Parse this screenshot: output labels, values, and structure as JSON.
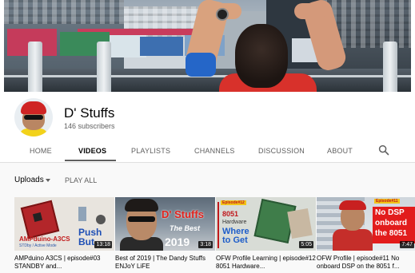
{
  "channel": {
    "name": "D' Stuffs",
    "subscribers": "146 subscribers"
  },
  "tabs": [
    {
      "label": "HOME"
    },
    {
      "label": "VIDEOS",
      "active": true
    },
    {
      "label": "PLAYLISTS"
    },
    {
      "label": "CHANNELS"
    },
    {
      "label": "DISCUSSION"
    },
    {
      "label": "ABOUT"
    }
  ],
  "filter": {
    "uploads_label": "Uploads",
    "play_all_label": "PLAY ALL"
  },
  "videos": [
    {
      "title": "AMPduino A3CS | episode#03 STANDBY and...",
      "duration": "13:18",
      "thumb_text": [
        "AMPduino-A3CS",
        "STDby / Active Mode",
        "Push",
        "But"
      ]
    },
    {
      "title": "Best of 2019 | The Dandy Stuffs ENJoY LiFE",
      "duration": "3:18",
      "thumb_text": [
        "D' Stuffs",
        "The Best",
        "2019"
      ]
    },
    {
      "title": "OFW Profile Learning | episode#12 8051 Hardware...",
      "duration": "5:05",
      "thumb_text": [
        "Episode#12",
        "8051",
        "Hardware",
        "Where",
        "to Get"
      ]
    },
    {
      "title": "OFW Profile | episode#11 No onboard DSP on the 8051 f...",
      "duration": "7:47",
      "thumb_text": [
        "Episode#11",
        "No DSP",
        "onboard",
        "the 8051"
      ]
    }
  ],
  "icons": {
    "search": "search-icon",
    "dropdown": "caret-down-icon"
  },
  "colors": {
    "text_primary": "#030303",
    "text_secondary": "#606060",
    "content_background": "#f9f9f9"
  }
}
